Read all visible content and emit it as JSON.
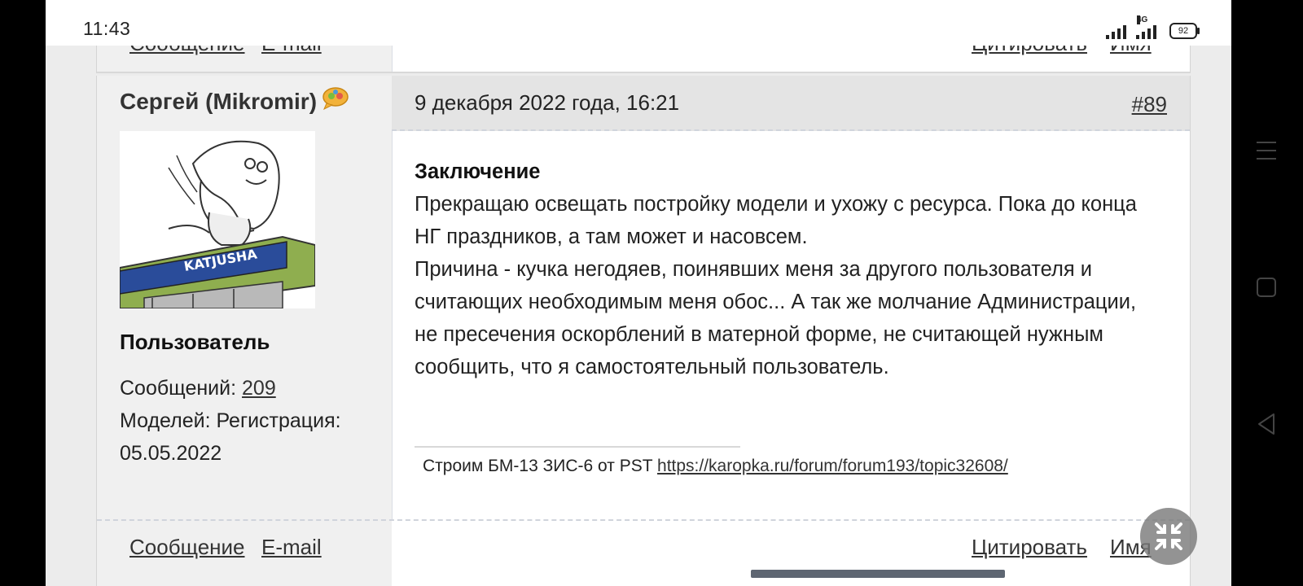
{
  "status_bar": {
    "time": "11:43",
    "network": "4G",
    "battery": "92"
  },
  "prev_post": {
    "message_link": "Сообщение",
    "email_link": "E-mail",
    "quote_link": "Цитировать",
    "name_link": "Имя"
  },
  "post": {
    "author": "Сергей (Mikromir)",
    "role": "Пользователь",
    "messages_label": "Сообщений:",
    "messages_count": "209",
    "models_label": "Моделей:",
    "registration_label": "Регистрация:",
    "registration_date": "05.05.2022",
    "avatar_caption": "KATJUSHA",
    "date": "9 декабря 2022 года, 16:21",
    "number": "#89",
    "heading": "Заключение",
    "paragraph1": "Прекращаю освещать постройку модели и ухожу с ресурса. Пока до конца НГ праздников, а там может и насовсем.",
    "paragraph2": "Причина - кучка негодяев, поинявших меня за другого пользователя и считающих необходимым меня обос... А так же молчание Администрации, не пресечения оскорблений в матерной форме, не считающей нужным сообщить, что я самостоятельный пользователь.",
    "signature_text": "Строим БМ-13 ЗИС-6 от PST",
    "signature_link": "https://karopka.ru/forum/forum193/topic32608/",
    "footer": {
      "message_link": "Сообщение",
      "email_link": "E-mail",
      "quote_link": "Цитировать",
      "name_link": "Имя"
    }
  },
  "icons": {
    "online": "online-status-icon",
    "fab": "collapse-fullscreen-icon",
    "nav_menu": "menu-icon",
    "nav_home": "home-square-icon",
    "nav_back": "back-triangle-icon"
  },
  "colors": {
    "user_col_bg": "#f0f0f0",
    "header_bg": "#e4e4e4",
    "content_bg": "#ffffff",
    "page_bg": "#ececec"
  }
}
